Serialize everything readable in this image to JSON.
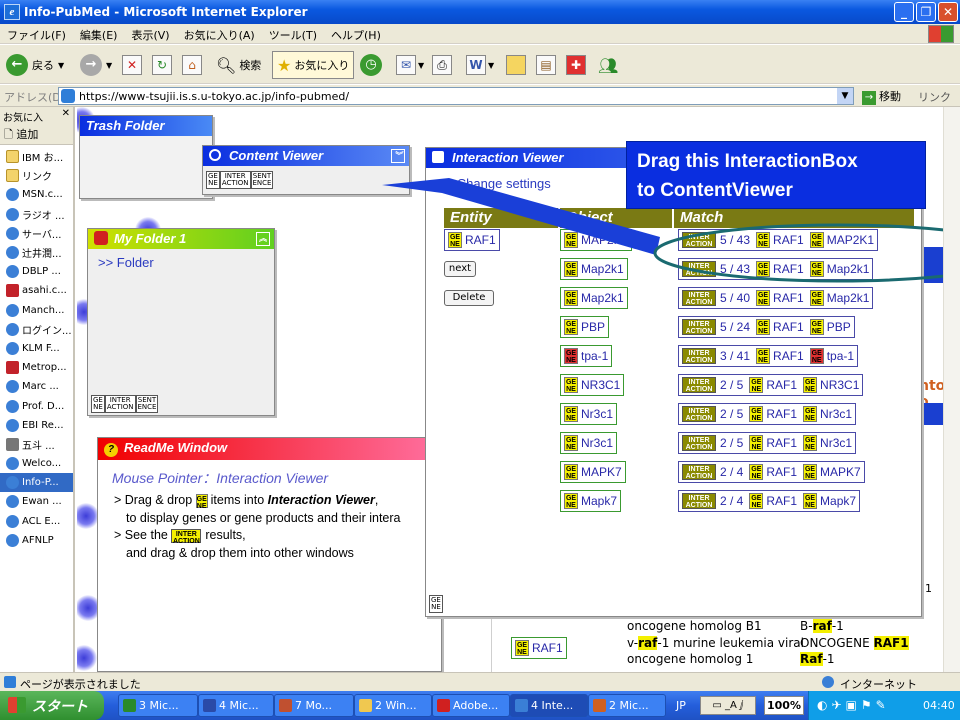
{
  "window": {
    "title": "Info-PubMed - Microsoft Internet Explorer"
  },
  "menu": [
    "ファイル(F)",
    "編集(E)",
    "表示(V)",
    "お気に入り(A)",
    "ツール(T)",
    "ヘルプ(H)"
  ],
  "toolbar": {
    "back": "戻る",
    "search": "検索",
    "favorites": "お気に入り"
  },
  "address": {
    "label": "アドレス(D)",
    "url": "https://www-tsujii.is.s.u-tokyo.ac.jp/info-pubmed/",
    "go": "移動",
    "links": "リンク"
  },
  "favorites": {
    "header": "お気に入",
    "add": "追加",
    "items": [
      {
        "label": "IBM お...",
        "icon": "folder-icon"
      },
      {
        "label": "リンク",
        "icon": "folder-icon"
      },
      {
        "label": "MSN.c...",
        "icon": "ie-page-icon"
      },
      {
        "label": "ラジオ ...",
        "icon": "ie-page-icon"
      },
      {
        "label": "サーバ...",
        "icon": "ie-page-icon"
      },
      {
        "label": "辻井潤...",
        "icon": "ie-page-icon"
      },
      {
        "label": "DBLP ...",
        "icon": "ie-page-icon"
      },
      {
        "label": "asahi.c...",
        "icon": "asahi-icon"
      },
      {
        "label": "Manch...",
        "icon": "ie-page-icon"
      },
      {
        "label": "ログイン...",
        "icon": "ie-page-icon"
      },
      {
        "label": "KLM F...",
        "icon": "ie-page-icon"
      },
      {
        "label": "Metrop...",
        "icon": "metro-icon"
      },
      {
        "label": "Marc ...",
        "icon": "ie-page-icon"
      },
      {
        "label": "Prof. D...",
        "icon": "ie-page-icon"
      },
      {
        "label": "EBI Re...",
        "icon": "ebi-icon"
      },
      {
        "label": "五斗 ...",
        "icon": "ict-icon"
      },
      {
        "label": "Welco...",
        "icon": "ie-page-icon"
      },
      {
        "label": "Info-P...",
        "icon": "ie-page-icon"
      },
      {
        "label": "Ewan ...",
        "icon": "ie-page-icon"
      },
      {
        "label": "ACL E...",
        "icon": "ie-page-icon"
      },
      {
        "label": "AFNLP",
        "icon": "ie-page-icon"
      }
    ]
  },
  "badges": {
    "ge_top": "GE",
    "ge_bottom": "NE",
    "inter_top": "INTER",
    "inter_bottom": "ACTION",
    "sent_top": "SENT",
    "sent_bottom": "ENCE"
  },
  "trash": {
    "title": "Trash Folder"
  },
  "content_viewer": {
    "title": "Content Viewer"
  },
  "my_folder": {
    "title": "My Folder 1",
    "link": ">> Folder"
  },
  "readme": {
    "title": "ReadMe Window",
    "subtitle": "Mouse Pointer：Interaction Viewer",
    "l1a": "> Drag & drop",
    "l1b": "items into",
    "l1c": "Interaction Viewer",
    "l1d": ",",
    "l2": "to display genes or gene products and their intera",
    "l3a": "> See the",
    "l3b": "results,",
    "l4": "and drag & drop them into other windows"
  },
  "interaction_viewer": {
    "title": "Interaction Viewer",
    "settings": ">> Change settings",
    "col_entity": "Entity",
    "col_object": "Object",
    "col_match": "Match",
    "entity": "RAF1",
    "next": "next",
    "delete": "Delete",
    "rows": [
      {
        "object": "MAP2K1",
        "ratio": "5 / 43",
        "subject": "RAF1",
        "target": "MAP2K1",
        "red": false
      },
      {
        "object": "Map2k1",
        "ratio": "5 / 43",
        "subject": "RAF1",
        "target": "Map2k1",
        "red": false
      },
      {
        "object": "Map2k1",
        "ratio": "5 / 40",
        "subject": "RAF1",
        "target": "Map2k1",
        "red": false
      },
      {
        "object": "PBP",
        "ratio": "5 / 24",
        "subject": "RAF1",
        "target": "PBP",
        "red": false
      },
      {
        "object": "tpa-1",
        "ratio": "3 / 41",
        "subject": "RAF1",
        "target": "tpa-1",
        "red": true
      },
      {
        "object": "NR3C1",
        "ratio": "2 / 5",
        "subject": "RAF1",
        "target": "NR3C1",
        "red": false
      },
      {
        "object": "Nr3c1",
        "ratio": "2 / 5",
        "subject": "RAF1",
        "target": "Nr3c1",
        "red": false
      },
      {
        "object": "Nr3c1",
        "ratio": "2 / 5",
        "subject": "RAF1",
        "target": "Nr3c1",
        "red": false
      },
      {
        "object": "MAPK7",
        "ratio": "2 / 4",
        "subject": "RAF1",
        "target": "MAPK7",
        "red": false
      },
      {
        "object": "Mapk7",
        "ratio": "2 / 4",
        "subject": "RAF1",
        "target": "Mapk7",
        "red": false
      }
    ]
  },
  "callout": {
    "line1": "Drag this InteractionBox",
    "line2": "to ContentViewer"
  },
  "background": {
    "side_text": "nto o",
    "num": "1",
    "row1_name": "oncogene homolog B1",
    "row1_sym_pre": "B-",
    "row1_sym_hl": "raf",
    "row1_sym_post": "-1",
    "row2_gene": "RAF1",
    "row2_name_pre": "v-",
    "row2_name_hl": "raf",
    "row2_name_post": "-1 murine leukemia viral",
    "row2_name2": "oncogene homolog 1",
    "row2_sym1_pre": "ONCOGENE ",
    "row2_sym1_hl": "RAF1",
    "row2_sym2_hl": "Raf",
    "row2_sym2_post": "-1"
  },
  "status": {
    "text": "ページが表示されました",
    "zone": "インターネット"
  },
  "taskbar": {
    "start": "スタート",
    "tasks": [
      "3 Mic...",
      "4 Mic...",
      "7 Mo...",
      "2 Win...",
      "Adobe...",
      "4 Inte...",
      "2 Mic..."
    ],
    "lang": "JP",
    "zoom": "100%",
    "time": "04:40"
  }
}
